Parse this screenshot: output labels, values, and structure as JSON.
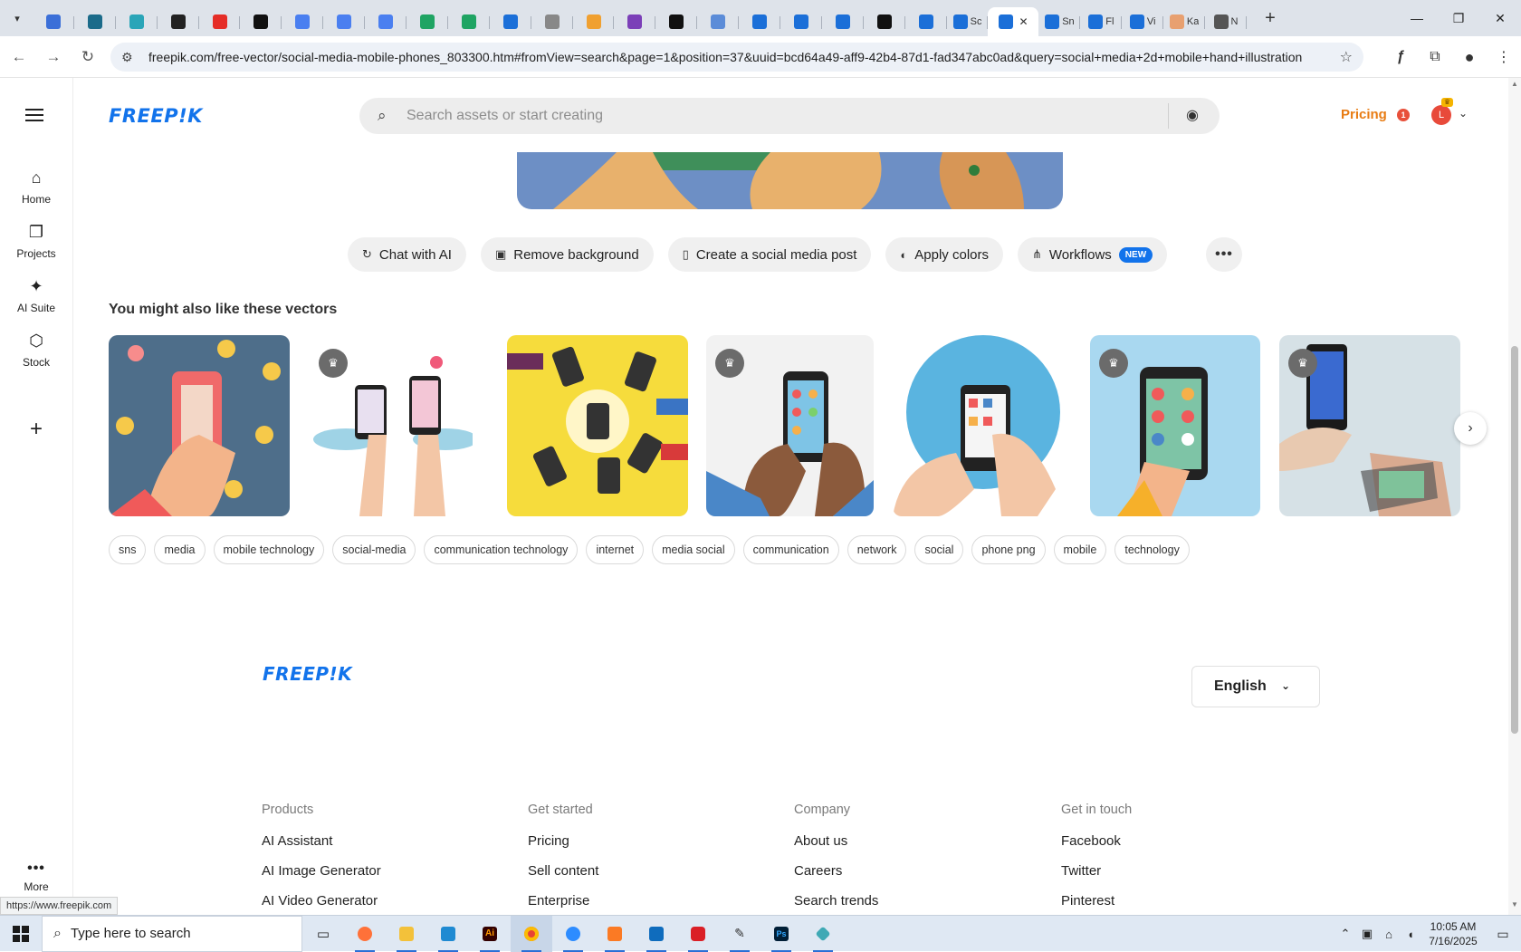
{
  "browser": {
    "tabs": [
      {
        "title": "",
        "color": "#3b6fd8"
      },
      {
        "title": "",
        "color": "#1b6b8a"
      },
      {
        "title": "",
        "color": "#2aa5b8"
      },
      {
        "title": "",
        "color": "#222222"
      },
      {
        "title": "",
        "color": "#e52d27"
      },
      {
        "title": "",
        "color": "#111111"
      },
      {
        "title": "",
        "color": "#4a7ff0"
      },
      {
        "title": "",
        "color": "#4a7ff0"
      },
      {
        "title": "",
        "color": "#4a7ff0"
      },
      {
        "title": "",
        "color": "#1fa463"
      },
      {
        "title": "",
        "color": "#1fa463"
      },
      {
        "title": "",
        "color": "#1b6fd8"
      },
      {
        "title": "",
        "color": "#888888"
      },
      {
        "title": "",
        "color": "#f0a030"
      },
      {
        "title": "",
        "color": "#7b3fb8"
      },
      {
        "title": "",
        "color": "#111111"
      },
      {
        "title": "",
        "color": "#5b8cd8"
      },
      {
        "title": "",
        "color": "#1b6fd8"
      },
      {
        "title": "",
        "color": "#1b6fd8"
      },
      {
        "title": "",
        "color": "#1b6fd8"
      },
      {
        "title": "",
        "color": "#111111"
      },
      {
        "title": "",
        "color": "#1b6fd8"
      },
      {
        "title": "Sc",
        "color": "#1b6fd8"
      }
    ],
    "active_tab": {
      "title": "",
      "color": "#1b6fd8",
      "close": "✕"
    },
    "tabs_after": [
      {
        "title": "Sn",
        "color": "#1b6fd8"
      },
      {
        "title": "Fl",
        "color": "#1b6fd8"
      },
      {
        "title": "Vi",
        "color": "#1b6fd8"
      },
      {
        "title": "Ka",
        "color": "#e8a070"
      },
      {
        "title": "N",
        "color": "#555555"
      }
    ],
    "new_tab": "+",
    "url": "freepik.com/free-vector/social-media-mobile-phones_803300.htm#fromView=search&page=1&position=37&uuid=bcd64a49-aff9-42b4-87d1-fad347abc0ad&query=social+media+2d+mobile+hand+illustration",
    "status_url": "https://www.freepik.com"
  },
  "sidebar": {
    "items": [
      {
        "label": "Home",
        "icon": "home-icon",
        "glyph": "⌂"
      },
      {
        "label": "Projects",
        "icon": "projects-icon",
        "glyph": "❐"
      },
      {
        "label": "AI Suite",
        "icon": "sparkle-icon",
        "glyph": "✦"
      },
      {
        "label": "Stock",
        "icon": "stock-icon",
        "glyph": "⬡"
      }
    ],
    "more_label": "More"
  },
  "header": {
    "logo": "FREEP!K",
    "search_placeholder": "Search assets or start creating",
    "pricing": "Pricing",
    "notification_count": "1",
    "avatar_letter": "L"
  },
  "tools": [
    {
      "label": "Chat with AI",
      "icon": "chat-icon",
      "glyph": "↻"
    },
    {
      "label": "Remove background",
      "icon": "remove-bg-icon",
      "glyph": "▣"
    },
    {
      "label": "Create a social media post",
      "icon": "phone-icon",
      "glyph": "▯"
    },
    {
      "label": "Apply colors",
      "icon": "palette-icon",
      "glyph": "◐"
    },
    {
      "label": "Workflows",
      "icon": "workflow-icon",
      "glyph": "⋔",
      "badge": "NEW"
    }
  ],
  "section_title": "You might also like these vectors",
  "cards": [
    {
      "name": "card-phone-network",
      "bg": "#4e6e8a",
      "premium": false
    },
    {
      "name": "card-two-phones-clouds",
      "bg": "#ffffff",
      "premium": true
    },
    {
      "name": "card-yellow-phones",
      "bg": "#f6dc3c",
      "premium": false
    },
    {
      "name": "card-hand-apps",
      "bg": "#f2f2f2",
      "premium": true
    },
    {
      "name": "card-blue-circle-phone",
      "bg": "#ffffff",
      "premium": false
    },
    {
      "name": "card-lightblue-phone",
      "bg": "#a9d8f0",
      "premium": true
    },
    {
      "name": "card-realistic-hands",
      "bg": "#d6e1e6",
      "premium": true
    }
  ],
  "tags": [
    "sns",
    "media",
    "mobile technology",
    "social-media",
    "communication technology",
    "internet",
    "media social",
    "communication",
    "network",
    "social",
    "phone png",
    "mobile",
    "technology"
  ],
  "footer": {
    "logo": "FREEP!K",
    "language": "English",
    "columns": [
      {
        "title": "Products",
        "links": [
          "AI Assistant",
          "AI Image Generator",
          "AI Video Generator"
        ]
      },
      {
        "title": "Get started",
        "links": [
          "Pricing",
          "Sell content",
          "Enterprise"
        ]
      },
      {
        "title": "Company",
        "links": [
          "About us",
          "Careers",
          "Search trends"
        ]
      },
      {
        "title": "Get in touch",
        "links": [
          "Facebook",
          "Twitter",
          "Pinterest"
        ]
      }
    ]
  },
  "taskbar": {
    "search_text": "Type here to search",
    "time": "10:05 AM",
    "date": "7/16/2025"
  }
}
